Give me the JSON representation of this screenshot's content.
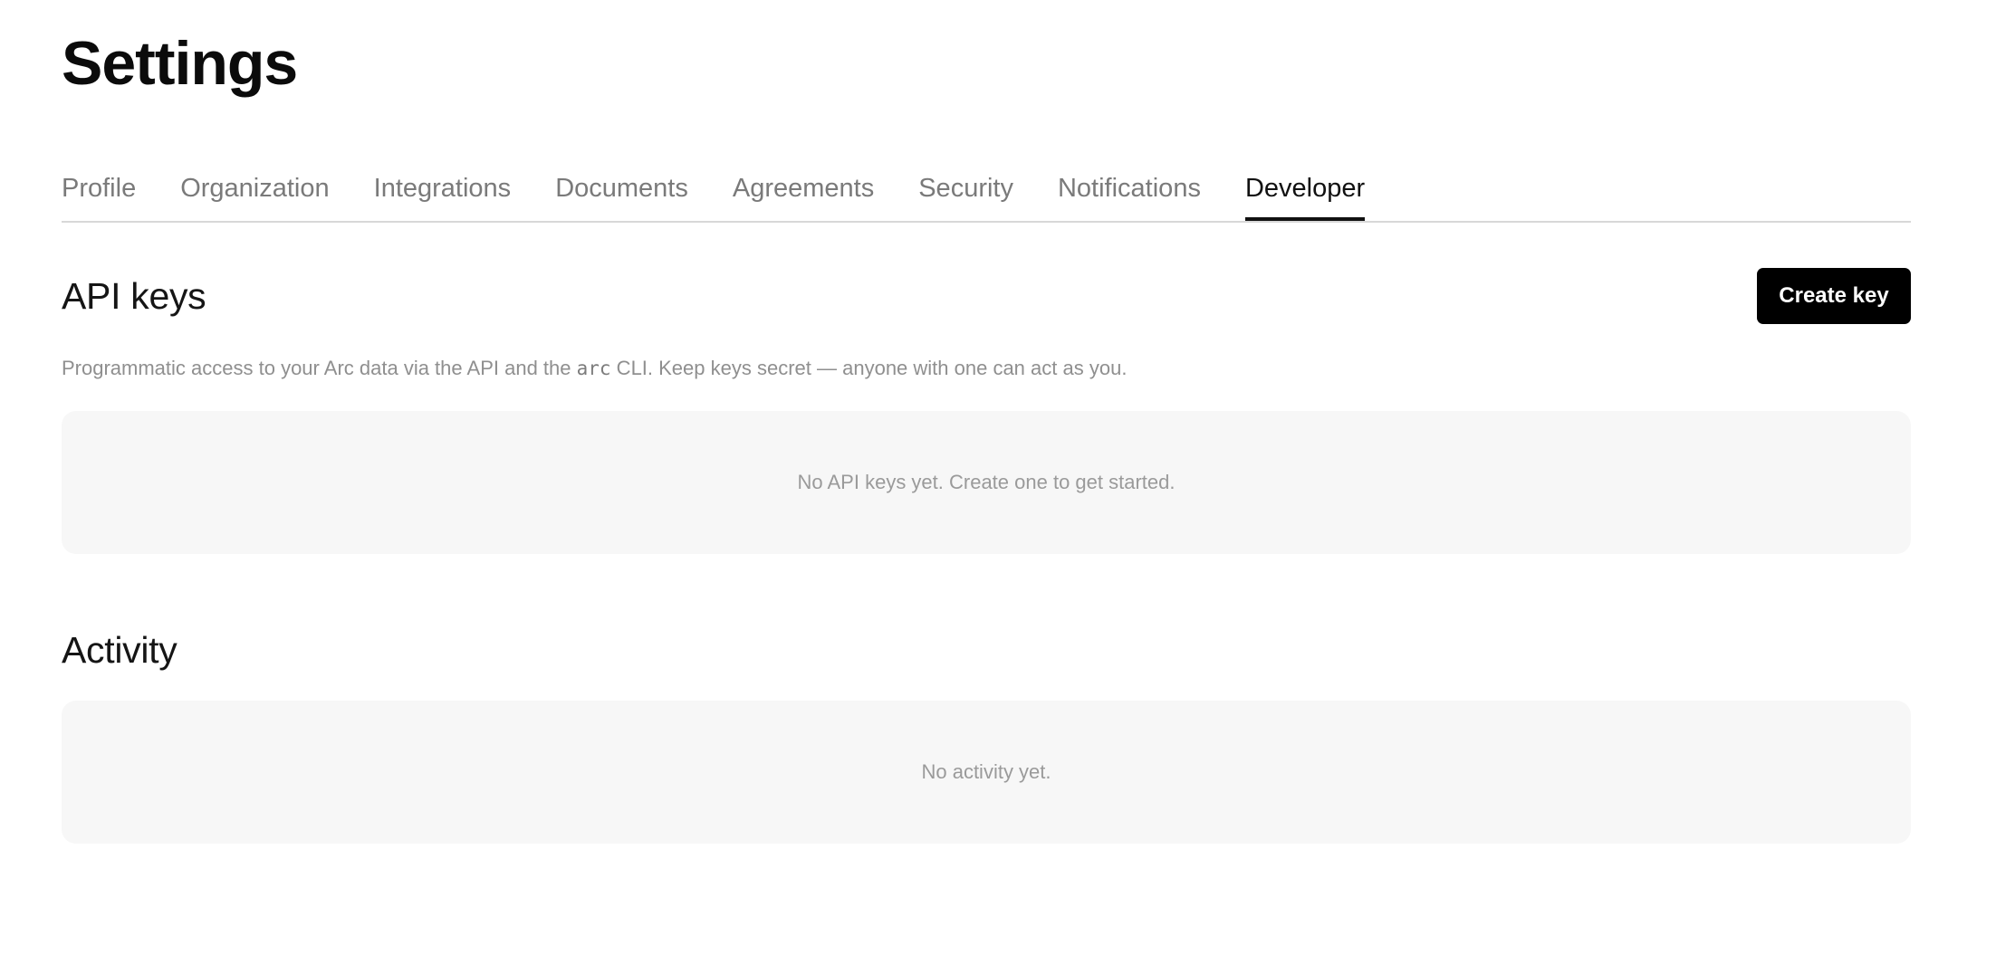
{
  "page": {
    "title": "Settings"
  },
  "tabs": [
    {
      "label": "Profile",
      "active": false
    },
    {
      "label": "Organization",
      "active": false
    },
    {
      "label": "Integrations",
      "active": false
    },
    {
      "label": "Documents",
      "active": false
    },
    {
      "label": "Agreements",
      "active": false
    },
    {
      "label": "Security",
      "active": false
    },
    {
      "label": "Notifications",
      "active": false
    },
    {
      "label": "Developer",
      "active": true
    }
  ],
  "api_keys": {
    "heading": "API keys",
    "create_label": "Create key",
    "description_before": "Programmatic access to your Arc data via the API and the ",
    "description_code": "arc",
    "description_after": " CLI. Keep keys secret — anyone with one can act as you.",
    "empty_text": "No API keys yet. Create one to get started."
  },
  "activity": {
    "heading": "Activity",
    "empty_text": "No activity yet."
  },
  "colors": {
    "background": "#ffffff",
    "primary_button": "#000000",
    "empty_panel": "#f7f7f7",
    "muted_text": "#8f8f8f",
    "inactive_tab": "#7a7a7a",
    "active_tab": "#111111"
  }
}
